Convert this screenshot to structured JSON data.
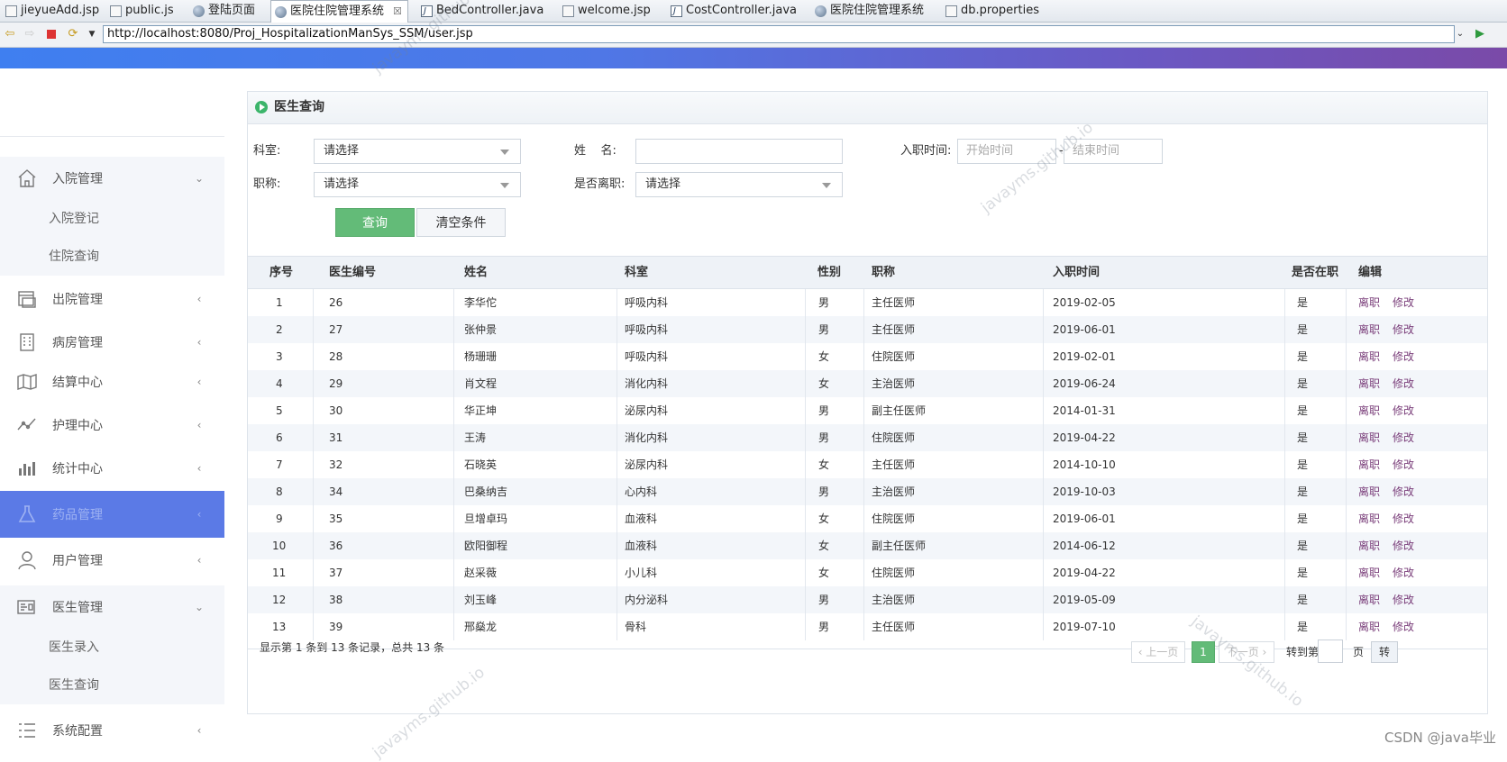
{
  "editor_tabs": [
    {
      "label": "jieyueAdd.jsp",
      "icon": "file-icon"
    },
    {
      "label": "public.js",
      "icon": "file-icon"
    },
    {
      "label": "登陆页面",
      "icon": "globe-icon"
    },
    {
      "label": "医院住院管理系统",
      "icon": "globe-icon",
      "active": true,
      "close": "☒"
    },
    {
      "label": "BedController.java",
      "icon": "java-icon"
    },
    {
      "label": "welcome.jsp",
      "icon": "file-icon"
    },
    {
      "label": "CostController.java",
      "icon": "java-icon"
    },
    {
      "label": "医院住院管理系统",
      "icon": "globe-icon"
    },
    {
      "label": "db.properties",
      "icon": "file-icon"
    }
  ],
  "url": "http://localhost:8080/Proj_HospitalizationManSys_SSM/user.jsp",
  "sidebar": {
    "groups": [
      {
        "label": "入院管理",
        "icon": "home-icon",
        "arrow": "⌄"
      },
      {
        "label": "出院管理",
        "icon": "window-icon",
        "arrow": "‹"
      },
      {
        "label": "病房管理",
        "icon": "building-icon",
        "arrow": "‹"
      },
      {
        "label": "结算中心",
        "icon": "map-icon",
        "arrow": "‹"
      },
      {
        "label": "护理中心",
        "icon": "trend-icon",
        "arrow": "‹"
      },
      {
        "label": "统计中心",
        "icon": "bar-chart-icon",
        "arrow": "‹"
      },
      {
        "label": "药品管理",
        "icon": "flask-icon",
        "arrow": "‹",
        "active": true
      },
      {
        "label": "用户管理",
        "icon": "user-icon",
        "arrow": "‹"
      },
      {
        "label": "医生管理",
        "icon": "doctor-card-icon",
        "arrow": "⌄"
      },
      {
        "label": "系统配置",
        "icon": "list-icon",
        "arrow": "‹"
      }
    ],
    "subitems": {
      "admission": [
        "入院登记",
        "住院查询"
      ],
      "doctor": [
        "医生录入",
        "医生查询"
      ]
    }
  },
  "panel": {
    "title": "医生查询"
  },
  "form": {
    "dept_label": "科室:",
    "dept_value": "请选择",
    "name_label": "姓    名:",
    "name_value": "",
    "hire_label": "入职时间:",
    "start_placeholder": "开始时间",
    "date_sep": "-",
    "end_placeholder": "结束时间",
    "title_label": "职称:",
    "title_value": "请选择",
    "leave_label": "是否离职:",
    "leave_value": "请选择",
    "search_btn": "查询",
    "clear_btn": "清空条件"
  },
  "table": {
    "headers": [
      "序号",
      "医生编号",
      "姓名",
      "科室",
      "性别",
      "职称",
      "入职时间",
      "是否在职",
      "编辑"
    ],
    "rows": [
      {
        "no": "1",
        "id": "26",
        "name": "李华佗",
        "dept": "呼吸内科",
        "sex": "男",
        "title": "主任医师",
        "date": "2019-02-05",
        "active": "是"
      },
      {
        "no": "2",
        "id": "27",
        "name": "张仲景",
        "dept": "呼吸内科",
        "sex": "男",
        "title": "主任医师",
        "date": "2019-06-01",
        "active": "是"
      },
      {
        "no": "3",
        "id": "28",
        "name": "杨珊珊",
        "dept": "呼吸内科",
        "sex": "女",
        "title": "住院医师",
        "date": "2019-02-01",
        "active": "是"
      },
      {
        "no": "4",
        "id": "29",
        "name": "肖文程",
        "dept": "消化内科",
        "sex": "女",
        "title": "主治医师",
        "date": "2019-06-24",
        "active": "是"
      },
      {
        "no": "5",
        "id": "30",
        "name": "华正坤",
        "dept": "泌尿内科",
        "sex": "男",
        "title": "副主任医师",
        "date": "2014-01-31",
        "active": "是"
      },
      {
        "no": "6",
        "id": "31",
        "name": "王涛",
        "dept": "消化内科",
        "sex": "男",
        "title": "住院医师",
        "date": "2019-04-22",
        "active": "是"
      },
      {
        "no": "7",
        "id": "32",
        "name": "石晓英",
        "dept": "泌尿内科",
        "sex": "女",
        "title": "主任医师",
        "date": "2014-10-10",
        "active": "是"
      },
      {
        "no": "8",
        "id": "34",
        "name": "巴桑纳吉",
        "dept": "心内科",
        "sex": "男",
        "title": "主治医师",
        "date": "2019-10-03",
        "active": "是"
      },
      {
        "no": "9",
        "id": "35",
        "name": "旦增卓玛",
        "dept": "血液科",
        "sex": "女",
        "title": "住院医师",
        "date": "2019-06-01",
        "active": "是"
      },
      {
        "no": "10",
        "id": "36",
        "name": "欧阳御程",
        "dept": "血液科",
        "sex": "女",
        "title": "副主任医师",
        "date": "2014-06-12",
        "active": "是"
      },
      {
        "no": "11",
        "id": "37",
        "name": "赵采薇",
        "dept": "小儿科",
        "sex": "女",
        "title": "住院医师",
        "date": "2019-04-22",
        "active": "是"
      },
      {
        "no": "12",
        "id": "38",
        "name": "刘玉峰",
        "dept": "内分泌科",
        "sex": "男",
        "title": "主治医师",
        "date": "2019-05-09",
        "active": "是"
      },
      {
        "no": "13",
        "id": "39",
        "name": "邢燊龙",
        "dept": "骨科",
        "sex": "男",
        "title": "主任医师",
        "date": "2019-07-10",
        "active": "是"
      }
    ],
    "action_leave": "离职",
    "action_edit": "修改"
  },
  "pager": {
    "info": "显示第 1 条到 13 条记录，总共 13 条",
    "prev": "‹ 上一页",
    "current": "1",
    "next": "下一页 ›",
    "goto_label": "转到第",
    "page_unit": "页",
    "go_btn": "转"
  },
  "watermark": "javayms.github.io",
  "csdn_mark": "CSDN @java毕业",
  "colors": {
    "accent_green": "#63bb78",
    "sidebar_active": "#5b7ae6",
    "link": "#7a3e7a"
  }
}
